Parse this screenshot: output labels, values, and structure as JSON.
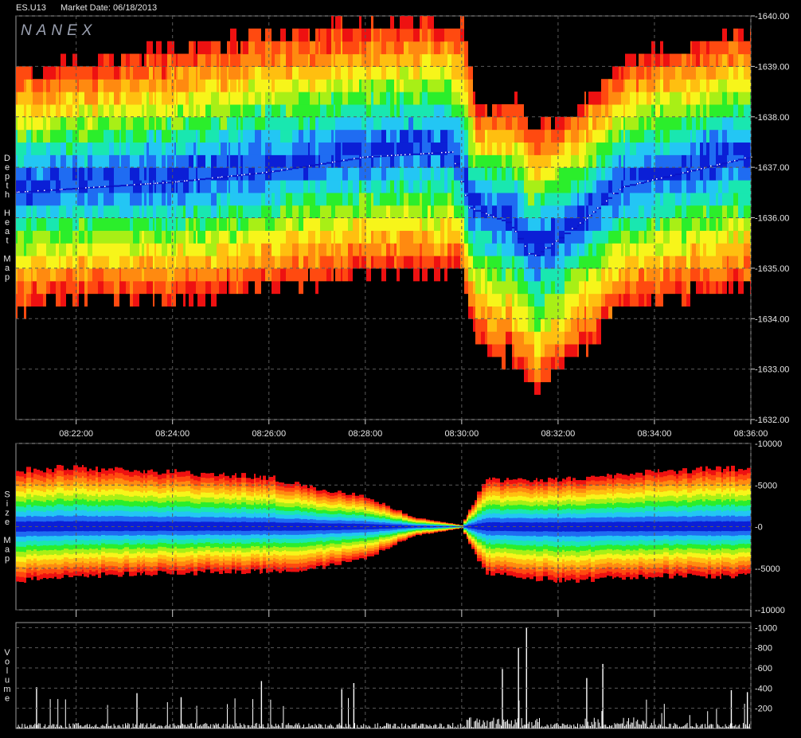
{
  "header": {
    "symbol": "ES.U13",
    "market_date": "Market Date: 06/18/2013",
    "logo": "NANEX"
  },
  "colors": {
    "background": "#000000",
    "grid": "#5a5a5a",
    "axis_text": "#e6e6e6",
    "scale": [
      "#0b1fd6",
      "#1f6cf2",
      "#23c6f4",
      "#19e7b0",
      "#2bee2b",
      "#a8ef16",
      "#f7f51a",
      "#ffbf10",
      "#ff8a10",
      "#ff4a10",
      "#ee1111"
    ]
  },
  "chart_data": [
    {
      "type": "heatmap",
      "ylabel": "Depth Heat Map",
      "x_ticks": [
        "08:22:00",
        "08:24:00",
        "08:26:00",
        "08:28:00",
        "08:30:00",
        "08:32:00",
        "08:34:00",
        "08:36:00"
      ],
      "x_range": [
        "08:20:45",
        "08:36:00"
      ],
      "y_ticks": [
        "1632.00",
        "1633.00",
        "1634.00",
        "1635.00",
        "1636.00",
        "1637.00",
        "1638.00",
        "1639.00",
        "1640.00"
      ],
      "ylim": [
        1632.0,
        1640.0
      ],
      "grid": true,
      "center_price_samples": [
        {
          "t": "08:20:45",
          "price": 1636.5
        },
        {
          "t": "08:24:00",
          "price": 1636.7
        },
        {
          "t": "08:26:00",
          "price": 1636.9
        },
        {
          "t": "08:28:00",
          "price": 1637.2
        },
        {
          "t": "08:29:50",
          "price": 1637.3
        },
        {
          "t": "08:30:10",
          "price": 1636.2
        },
        {
          "t": "08:31:00",
          "price": 1635.9
        },
        {
          "t": "08:31:30",
          "price": 1635.2
        },
        {
          "t": "08:32:30",
          "price": 1635.9
        },
        {
          "t": "08:33:20",
          "price": 1636.6
        },
        {
          "t": "08:36:00",
          "price": 1637.2
        }
      ],
      "depth_extent_samples": [
        {
          "t": "08:20:45",
          "top": 1638.8,
          "bottom": 1634.0
        },
        {
          "t": "08:22:00",
          "top": 1638.9,
          "bottom": 1634.3
        },
        {
          "t": "08:24:00",
          "top": 1639.2,
          "bottom": 1634.2
        },
        {
          "t": "08:26:00",
          "top": 1639.5,
          "bottom": 1634.5
        },
        {
          "t": "08:28:00",
          "top": 1639.8,
          "bottom": 1634.8
        },
        {
          "t": "08:30:00",
          "top": 1639.7,
          "bottom": 1634.8
        },
        {
          "t": "08:30:20",
          "top": 1638.0,
          "bottom": 1633.3
        },
        {
          "t": "08:31:00",
          "top": 1638.3,
          "bottom": 1633.1
        },
        {
          "t": "08:31:30",
          "top": 1637.7,
          "bottom": 1632.4
        },
        {
          "t": "08:32:30",
          "top": 1638.2,
          "bottom": 1633.3
        },
        {
          "t": "08:33:30",
          "top": 1639.0,
          "bottom": 1634.2
        },
        {
          "t": "08:36:00",
          "top": 1639.6,
          "bottom": 1634.5
        }
      ]
    },
    {
      "type": "heatmap",
      "ylabel": "Size Map",
      "y_ticks": [
        "10000",
        "5000",
        "0",
        "-5000",
        "-10000"
      ],
      "ylim": [
        -10000,
        10000
      ],
      "grid": true,
      "size_extent_samples": [
        {
          "t": "08:20:45",
          "ask": 7000,
          "bid": -6800
        },
        {
          "t": "08:22:00",
          "ask": 7400,
          "bid": -6200
        },
        {
          "t": "08:24:00",
          "ask": 6800,
          "bid": -5800
        },
        {
          "t": "08:26:00",
          "ask": 6200,
          "bid": -5600
        },
        {
          "t": "08:27:00",
          "ask": 4700,
          "bid": -5200
        },
        {
          "t": "08:28:00",
          "ask": 3800,
          "bid": -4000
        },
        {
          "t": "08:29:00",
          "ask": 1200,
          "bid": -1200
        },
        {
          "t": "08:30:00",
          "ask": 200,
          "bid": -200
        },
        {
          "t": "08:30:30",
          "ask": 5800,
          "bid": -5800
        },
        {
          "t": "08:32:00",
          "ask": 5900,
          "bid": -6800
        },
        {
          "t": "08:34:00",
          "ask": 6800,
          "bid": -6200
        },
        {
          "t": "08:36:00",
          "ask": 7400,
          "bid": -6200
        }
      ]
    },
    {
      "type": "bar",
      "ylabel": "Volume",
      "y_ticks": [
        "1000",
        "800",
        "600",
        "400",
        "200"
      ],
      "ylim": [
        0,
        1050
      ],
      "grid": true,
      "volume_spikes": [
        {
          "t": "08:21:10",
          "v": 410
        },
        {
          "t": "08:23:15",
          "v": 350
        },
        {
          "t": "08:24:10",
          "v": 310
        },
        {
          "t": "08:25:50",
          "v": 470
        },
        {
          "t": "08:27:30",
          "v": 390
        },
        {
          "t": "08:27:45",
          "v": 450
        },
        {
          "t": "08:30:50",
          "v": 590
        },
        {
          "t": "08:31:10",
          "v": 800
        },
        {
          "t": "08:31:20",
          "v": 1000
        },
        {
          "t": "08:32:35",
          "v": 500
        },
        {
          "t": "08:32:55",
          "v": 640
        },
        {
          "t": "08:35:35",
          "v": 380
        },
        {
          "t": "08:35:55",
          "v": 360
        }
      ]
    }
  ]
}
